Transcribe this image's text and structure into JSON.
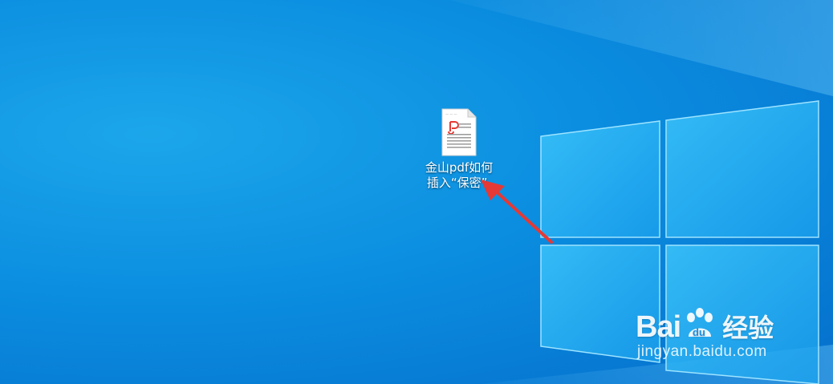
{
  "desktop": {
    "file_icon": {
      "icon": "pdf-file-icon",
      "label": "金山pdf如何\n插入“保密”."
    }
  },
  "watermark": {
    "brand_latin": "Bai",
    "brand_du": "du",
    "brand_cn": "经验",
    "url": "jingyan.baidu.com"
  },
  "colors": {
    "background": "#0b8ee0",
    "window_pane": "#29b6f6",
    "annotation_arrow": "#e53935",
    "pdf_accent": "#e53935"
  }
}
